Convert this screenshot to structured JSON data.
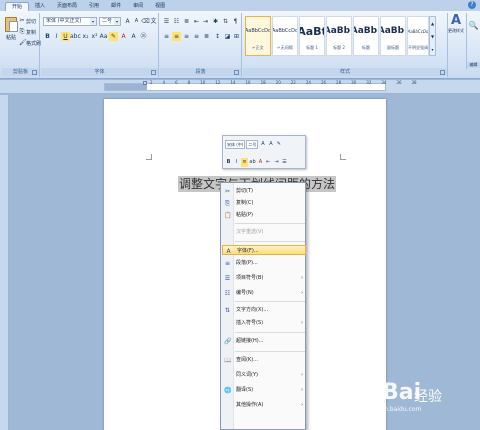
{
  "ribbon": {
    "tabs": [
      "开始",
      "插入",
      "页面布局",
      "引用",
      "邮件",
      "审阅",
      "视图"
    ],
    "clipboard": {
      "paste": "粘贴",
      "cut": "剪切",
      "copy": "复制",
      "format_painter": "格式刷",
      "label": "剪贴板"
    },
    "font": {
      "font_name": "宋体 (中文正文)",
      "font_size": "二号",
      "label": "字体"
    },
    "paragraph": {
      "label": "段落"
    },
    "styles": {
      "label": "样式",
      "tiles": [
        {
          "sample": "AaBbCcDd",
          "name": "↵正文"
        },
        {
          "sample": "AaBbCcDd",
          "name": "↵无间隔"
        },
        {
          "sample": "AaBt",
          "name": "标题 1"
        },
        {
          "sample": "AaBb(",
          "name": "标题 2"
        },
        {
          "sample": "AaBb(",
          "name": "标题"
        },
        {
          "sample": "AaBb(",
          "name": "副标题"
        },
        {
          "sample": "AaBbCcDd",
          "name": "不明显强调"
        }
      ],
      "change_styles": "更改样式"
    },
    "editing": {
      "label": "编辑"
    }
  },
  "ruler": {
    "numbers": [
      "2",
      "4",
      "6",
      "8",
      "10",
      "12",
      "14",
      "16",
      "18",
      "20",
      "22",
      "24",
      "26",
      "28",
      "30",
      "32",
      "34",
      "36",
      "38"
    ]
  },
  "document": {
    "text": "调整文字与下划线间距的方法"
  },
  "mini_toolbar": {
    "font": "宋体 (中)",
    "size": "二号"
  },
  "context_menu": {
    "items": [
      {
        "label": "剪切(T)",
        "icon": "✂"
      },
      {
        "label": "复制(C)",
        "icon": "⎘"
      },
      {
        "label": "粘贴(P)",
        "icon": "📋"
      },
      {
        "label": "汉字重选(V)",
        "icon": ""
      },
      {
        "label": "字体(F)...",
        "icon": "A"
      },
      {
        "label": "段落(P)...",
        "icon": "≡"
      },
      {
        "label": "项目符号(B)",
        "icon": "☰"
      },
      {
        "label": "编号(N)",
        "icon": "☷"
      },
      {
        "label": "文字方向(X)...",
        "icon": "⇅"
      },
      {
        "label": "插入符号(S)",
        "icon": ""
      },
      {
        "label": "超链接(H)...",
        "icon": "🔗"
      },
      {
        "label": "查阅(K)...",
        "icon": "📖"
      },
      {
        "label": "同义词(Y)",
        "icon": ""
      },
      {
        "label": "翻译(S)",
        "icon": "🌐"
      },
      {
        "label": "其他操作(A)",
        "icon": ""
      }
    ]
  },
  "watermark": {
    "brand": "Bai",
    "text": "经验",
    "sub": "jingyan.baidu.com"
  }
}
